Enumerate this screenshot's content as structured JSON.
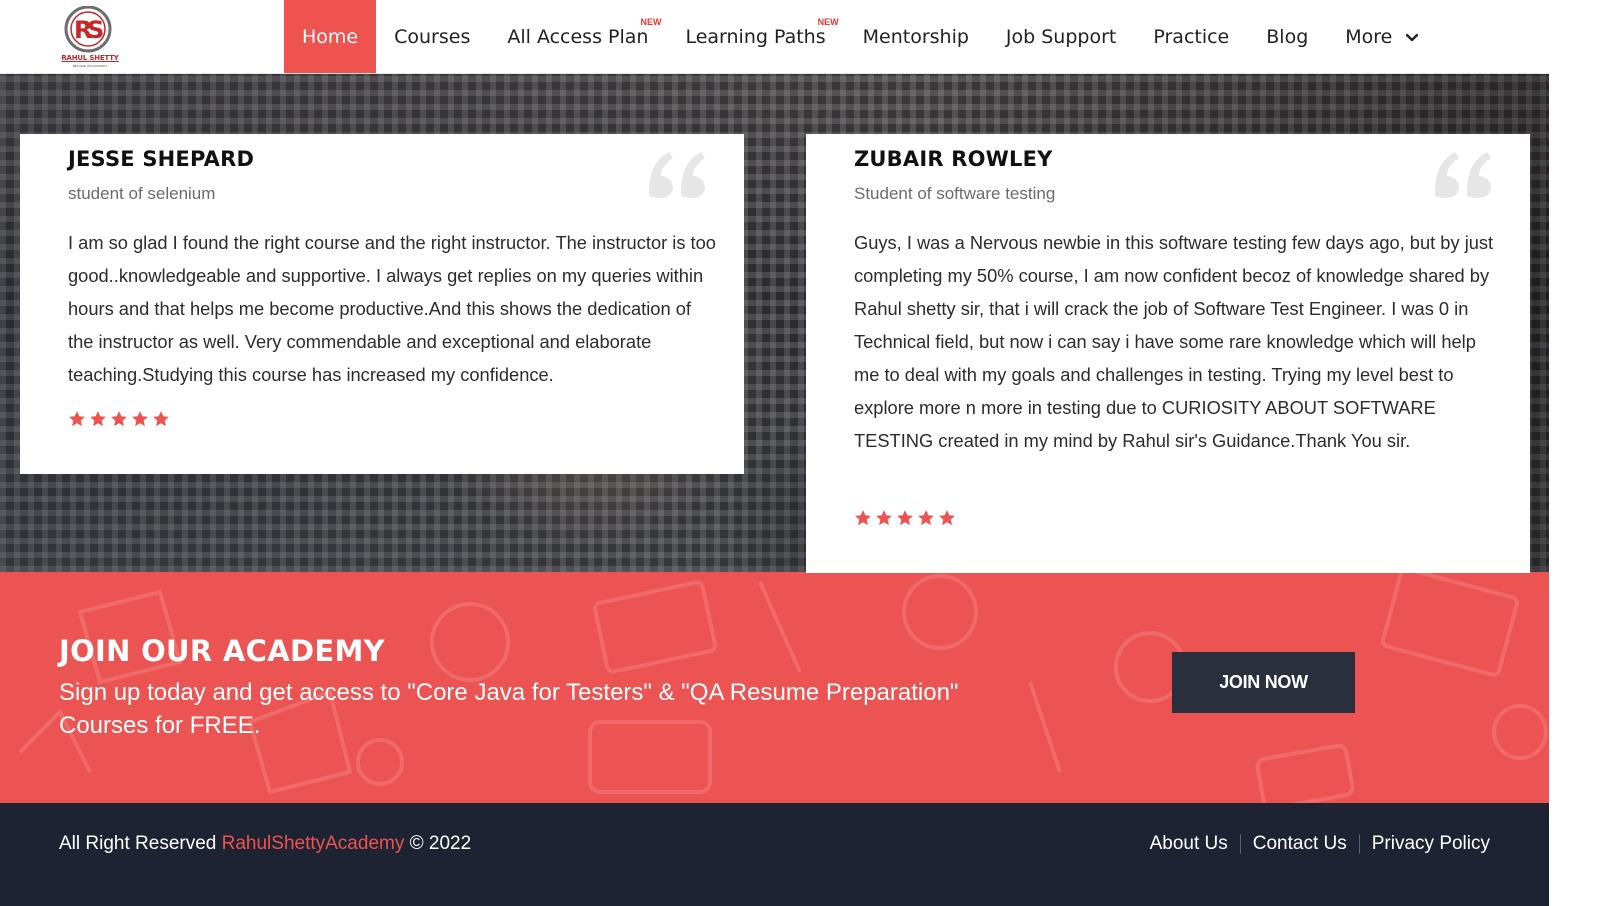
{
  "brand": {
    "logo_text": "RAHUL SHETTY",
    "logo_tagline": "BECOME TEST EXPERT",
    "accent_color": "#ef5350",
    "dark_color": "#1e2333"
  },
  "nav": {
    "items": [
      {
        "label": "Home",
        "active": true
      },
      {
        "label": "Courses"
      },
      {
        "label": "All Access Plan",
        "badge": "NEW"
      },
      {
        "label": "Learning Paths",
        "badge": "NEW"
      },
      {
        "label": "Mentorship"
      },
      {
        "label": "Job Support"
      },
      {
        "label": "Practice"
      },
      {
        "label": "Blog"
      },
      {
        "label": "More"
      }
    ]
  },
  "testimonials": [
    {
      "name": "JESSE SHEPARD",
      "role": "student of selenium",
      "text": "I am so glad I found the right course and the right instructor. The instructor is too good..knowledgeable and supportive. I always get replies on my queries within hours and that helps me become productive.And this shows the dedication of the instructor as well. Very commendable and exceptional and elaborate teaching.Studying this course has increased my confidence.",
      "rating": 5
    },
    {
      "name": "ZUBAIR ROWLEY",
      "role": "Student of software testing",
      "text": "Guys, I was a Nervous newbie in this software testing few days ago, but by just completing my 50% course, I am now confident becoz of knowledge shared by Rahul shetty sir, that i will crack the job of Software Test Engineer. I was 0 in Technical field, but now i can say i have some rare knowledge which will help me to deal with my goals and challenges in testing. Trying my level best to explore more n more in testing due to CURIOSITY ABOUT SOFTWARE TESTING created in my mind by Rahul sir's Guidance.Thank You sir.",
      "rating": 5
    }
  ],
  "cta": {
    "title": "JOIN OUR ACADEMY",
    "subtitle": "Sign up today and get access to \"Core Java for Testers\" & \"QA Resume Preparation\" Courses for FREE.",
    "button_label": "JOIN NOW"
  },
  "footer": {
    "copyright_prefix": "All Right Reserved",
    "brand_link": "RahulShettyAcademy",
    "copyright_suffix": "© 2022",
    "links": [
      "About Us",
      "Contact Us",
      "Privacy Policy"
    ]
  }
}
